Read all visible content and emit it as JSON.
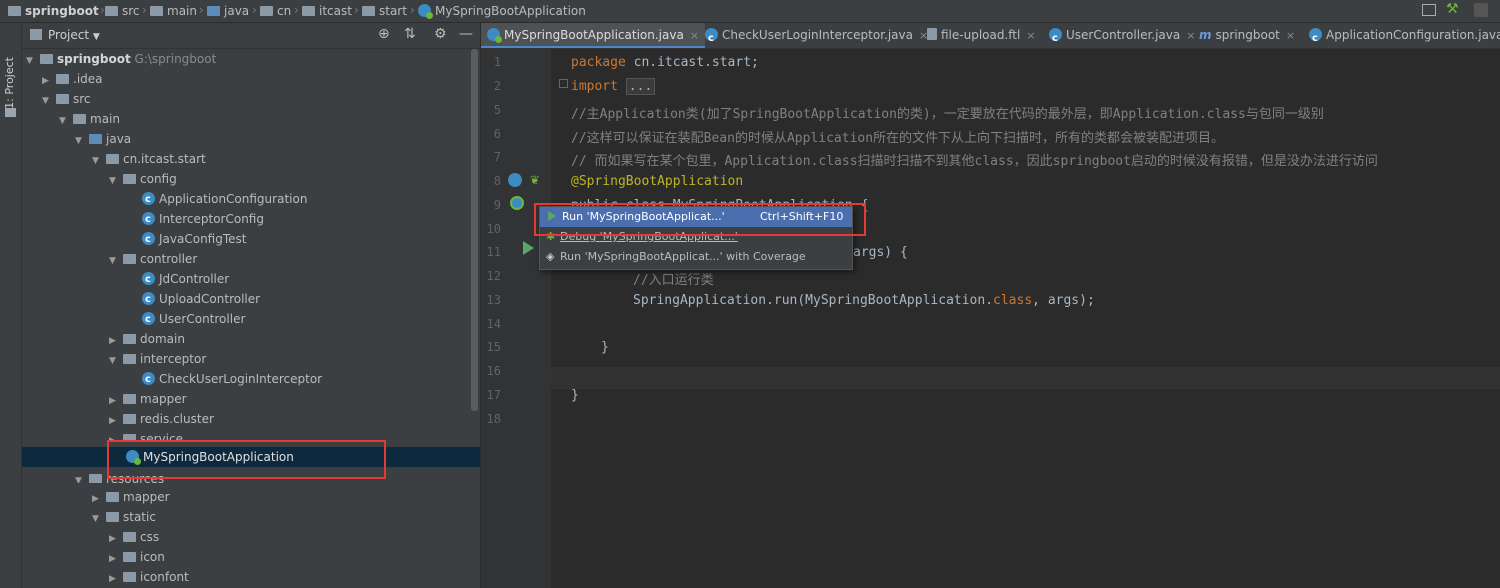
{
  "breadcrumb": {
    "items": [
      "springboot",
      "src",
      "main",
      "java",
      "cn",
      "itcast",
      "start",
      "MySpringBootApplication"
    ]
  },
  "sidebar_strip": {
    "label": "1: Project"
  },
  "project_panel": {
    "title": "Project",
    "tree": [
      {
        "label": "springboot",
        "extra": "G:\\springboot",
        "level": 0,
        "icon": "folder-icon",
        "arrow": "expanded"
      },
      {
        "label": ".idea",
        "level": 1,
        "icon": "folder-icon",
        "arrow": "collapsed"
      },
      {
        "label": "src",
        "level": 1,
        "icon": "folder-icon",
        "arrow": "expanded"
      },
      {
        "label": "main",
        "level": 2,
        "icon": "folder-icon",
        "arrow": "expanded"
      },
      {
        "label": "java",
        "level": 3,
        "icon": "source-folder-icon",
        "arrow": "expanded"
      },
      {
        "label": "cn.itcast.start",
        "level": 4,
        "icon": "package-icon",
        "arrow": "expanded"
      },
      {
        "label": "config",
        "level": 5,
        "icon": "package-icon",
        "arrow": "expanded"
      },
      {
        "label": "ApplicationConfiguration",
        "level": 6,
        "icon": "class-icon",
        "arrow": "none"
      },
      {
        "label": "InterceptorConfig",
        "level": 6,
        "icon": "class-icon",
        "arrow": "none"
      },
      {
        "label": "JavaConfigTest",
        "level": 6,
        "icon": "class-icon",
        "arrow": "none"
      },
      {
        "label": "controller",
        "level": 5,
        "icon": "package-icon",
        "arrow": "expanded"
      },
      {
        "label": "JdController",
        "level": 6,
        "icon": "class-icon",
        "arrow": "none"
      },
      {
        "label": "UploadController",
        "level": 6,
        "icon": "class-icon",
        "arrow": "none"
      },
      {
        "label": "UserController",
        "level": 6,
        "icon": "class-icon",
        "arrow": "none"
      },
      {
        "label": "domain",
        "level": 5,
        "icon": "package-icon",
        "arrow": "collapsed"
      },
      {
        "label": "interceptor",
        "level": 5,
        "icon": "package-icon",
        "arrow": "expanded"
      },
      {
        "label": "CheckUserLoginInterceptor",
        "level": 6,
        "icon": "class-icon",
        "arrow": "none"
      },
      {
        "label": "mapper",
        "level": 5,
        "icon": "package-icon",
        "arrow": "collapsed"
      },
      {
        "label": "redis.cluster",
        "level": 5,
        "icon": "package-icon",
        "arrow": "collapsed"
      },
      {
        "label": "service",
        "level": 5,
        "icon": "package-icon",
        "arrow": "collapsed"
      },
      {
        "label": "MySpringBootApplication",
        "level": 5,
        "icon": "spring-boot-class-icon",
        "arrow": "none",
        "selected": true
      },
      {
        "label": "resources",
        "level": 3,
        "icon": "resources-folder-icon",
        "arrow": "expanded"
      },
      {
        "label": "mapper",
        "level": 4,
        "icon": "folder-icon",
        "arrow": "collapsed"
      },
      {
        "label": "static",
        "level": 4,
        "icon": "folder-icon",
        "arrow": "expanded"
      },
      {
        "label": "css",
        "level": 5,
        "icon": "folder-icon",
        "arrow": "collapsed"
      },
      {
        "label": "icon",
        "level": 5,
        "icon": "folder-icon",
        "arrow": "collapsed"
      },
      {
        "label": "iconfont",
        "level": 5,
        "icon": "folder-icon",
        "arrow": "collapsed"
      }
    ]
  },
  "tabs": [
    {
      "label": "MySpringBootApplication.java",
      "active": true
    },
    {
      "label": "CheckUserLoginInterceptor.java"
    },
    {
      "label": "file-upload.ftl"
    },
    {
      "label": "UserController.java"
    },
    {
      "label": "springboot"
    },
    {
      "label": "ApplicationConfiguration.java"
    }
  ],
  "editor": {
    "line_numbers": [
      "1",
      "2",
      "5",
      "6",
      "7",
      "8",
      "9",
      "10",
      "11",
      "12",
      "13",
      "14",
      "15",
      "16",
      "17",
      "18"
    ],
    "lines": {
      "l1_kw": "package",
      "l1_rest": " cn.itcast.start;",
      "l2_kw": "import",
      "l2_fold": "...",
      "l5": "//主Application类(加了SpringBootApplication的类)，一定要放在代码的最外层，即Application.class与包同一级别",
      "l6": "//这样可以保证在装配Bean的时候从Application所在的文件下从上向下扫描时，所有的类都会被装配进项目。",
      "l7": "// 而如果写在某个包里，Application.class扫描时扫描不到其他class，因此springboot启动的时候没有报错，但是没办法进行访问",
      "l8": "@SpringBootApplication",
      "l9": "public class MySpringBootApplication {",
      "l11_tail": "args) {",
      "l12": "//入口运行类",
      "l13_a": "SpringApplication.run(MySpringBootApplication.",
      "l13_kw": "class",
      "l13_b": ", args);",
      "l15": "}",
      "l17": "}"
    }
  },
  "run_popup": {
    "items": [
      {
        "label": "Run 'MySpringBootApplicat...'",
        "shortcut": "Ctrl+Shift+F10",
        "selected": true
      },
      {
        "label": "Debug 'MySpringBootApplicat...'",
        "shortcut": ""
      },
      {
        "label": "Run 'MySpringBootApplicat...' with Coverage",
        "shortcut": ""
      }
    ]
  },
  "colors": {
    "highlight_box": "#e53935",
    "selected_menu": "#4b6eaf",
    "keyword": "#cc7832",
    "comment": "#808080",
    "annotation": "#bbb529"
  }
}
